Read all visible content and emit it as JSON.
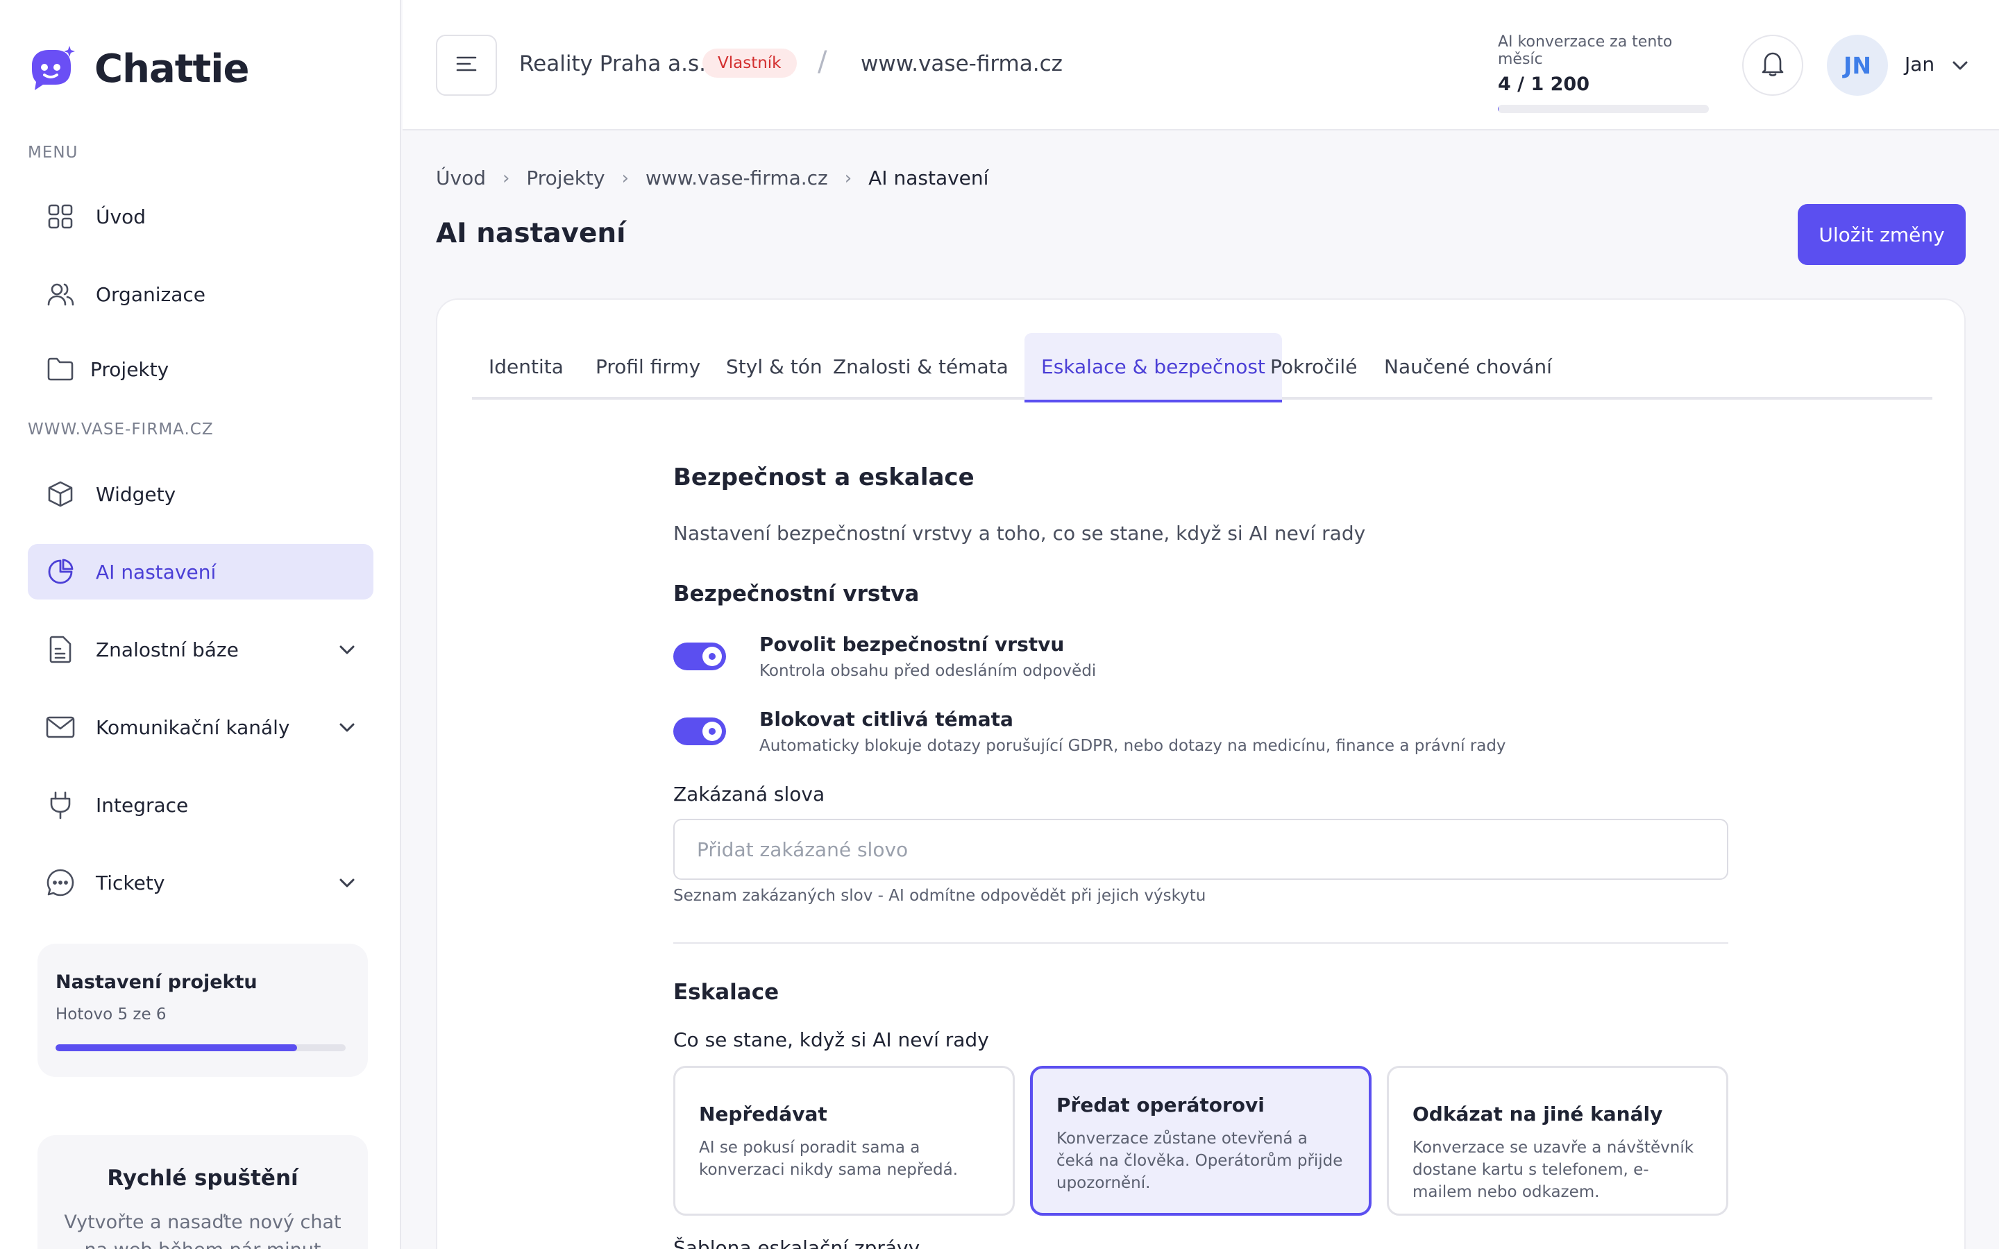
{
  "brand": {
    "name": "Chattie"
  },
  "sidebar": {
    "menu_label": "MENU",
    "project_label": "WWW.VASE-FIRMA.CZ",
    "menu_items": [
      {
        "label": "Úvod",
        "icon": "grid-icon"
      },
      {
        "label": "Organizace",
        "icon": "users-icon"
      },
      {
        "label": "Projekty",
        "icon": "folder-icon"
      }
    ],
    "project_items": [
      {
        "label": "Widgety",
        "icon": "cube-icon"
      },
      {
        "label": "AI nastavení",
        "icon": "pie-chart-icon",
        "active": true
      },
      {
        "label": "Znalostní báze",
        "icon": "document-icon",
        "expandable": true
      },
      {
        "label": "Komunikační kanály",
        "icon": "mail-icon",
        "expandable": true
      },
      {
        "label": "Integrace",
        "icon": "plug-icon"
      },
      {
        "label": "Tickety",
        "icon": "chat-bubble-icon",
        "expandable": true
      }
    ],
    "setup_card": {
      "title": "Nastavení projektu",
      "subtitle": "Hotovo 5 ze 6",
      "progress": 0.833
    },
    "quick_start": {
      "title": "Rychlé spuštění",
      "subtitle": "Vytvořte a nasaďte nový chat na web během pár minut"
    }
  },
  "topbar": {
    "org_name": "Reality Praha a.s.",
    "role_badge": "Vlastník",
    "separator": "/",
    "site": "www.vase-firma.cz",
    "usage_label": "AI konverzace za tento měsíc",
    "usage_value": "4 / 1 200",
    "usage_progress": 0.0033,
    "avatar_initials": "JN",
    "user_name": "Jan"
  },
  "breadcrumb": [
    "Úvod",
    "Projekty",
    "www.vase-firma.cz",
    "AI nastavení"
  ],
  "page": {
    "title": "AI nastavení",
    "save_label": "Uložit změny"
  },
  "tabs": [
    {
      "label": "Identita"
    },
    {
      "label": "Profil firmy"
    },
    {
      "label": "Styl & tón"
    },
    {
      "label": "Znalosti & témata"
    },
    {
      "label": "Eskalace & bezpečnost",
      "active": true
    },
    {
      "label": "Pokročilé"
    },
    {
      "label": "Naučené chování"
    }
  ],
  "security": {
    "title": "Bezpečnost a eskalace",
    "description": "Nastavení bezpečnostní vrstvy a toho, co se stane, když si AI neví rady",
    "layer_title": "Bezpečnostní vrstva",
    "toggles": [
      {
        "title": "Povolit bezpečnostní vrstvu",
        "subtitle": "Kontrola obsahu před odesláním odpovědi",
        "on": true
      },
      {
        "title": "Blokovat citlivá témata",
        "subtitle": "Automaticky blokuje dotazy porušující GDPR, nebo dotazy na medicínu, finance a právní rady",
        "on": true
      }
    ],
    "banned_words_label": "Zakázaná slova",
    "banned_words_placeholder": "Přidat zakázané slovo",
    "banned_words_value": "",
    "banned_words_hint": "Seznam zakázaných slov - AI odmítne odpovědět při jejich výskytu"
  },
  "escalation": {
    "title": "Eskalace",
    "question": "Co se stane, když si AI neví rady",
    "options": [
      {
        "title": "Nepředávat",
        "desc": "AI se pokusí poradit sama a konverzaci nikdy sama nepředá.",
        "selected": false
      },
      {
        "title": "Předat operátorovi",
        "desc": "Konverzace zůstane otevřená a čeká na člověka. Operátorům přijde upozornění.",
        "selected": true
      },
      {
        "title": "Odkázat na jiné kanály",
        "desc": "Konverzace se uzavře a návštěvník dostane kartu s telefonem, e-mailem nebo odkazem.",
        "selected": false
      }
    ],
    "template_label": "Šablona eskalační zprávy"
  },
  "colors": {
    "accent": "#5b4ff0",
    "active_bg": "#e6e6fb",
    "badge_text": "#d32f2f",
    "badge_bg": "#fdeaea"
  }
}
